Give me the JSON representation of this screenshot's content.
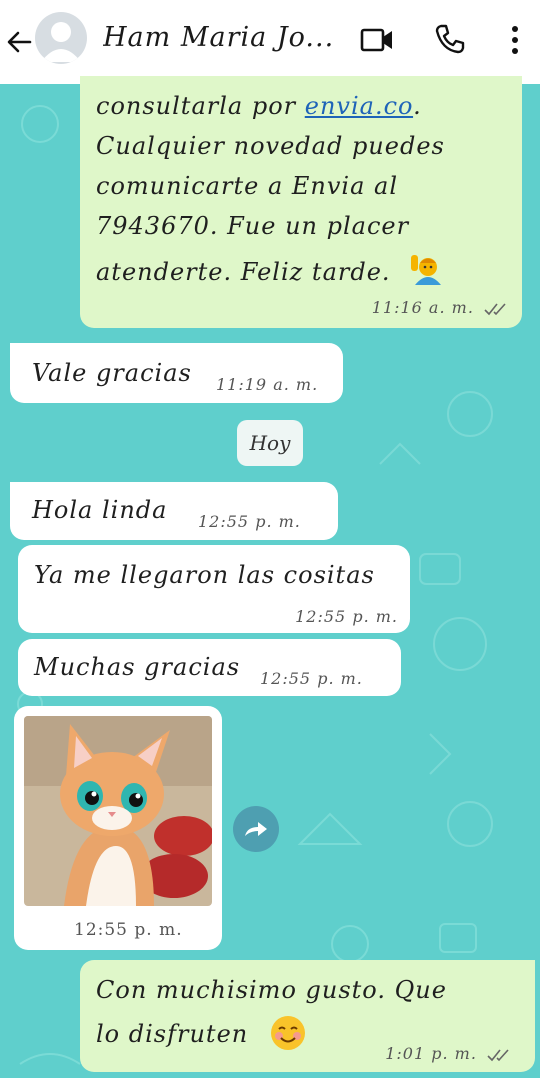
{
  "header": {
    "contact_name": "Ham Maria Jo..."
  },
  "messages": [
    {
      "lines_a": "consultarla por ",
      "link": "envia.co",
      "lines_b": ".",
      "line2": "Cualquier novedad puedes",
      "line3": "comunicarte a Envia al",
      "line4": "7943670. Fue un placer",
      "line5": "atenderte. Feliz tarde.",
      "time": "11:16 a. m."
    },
    {
      "text": "Vale gracias",
      "time": "11:19 a. m."
    },
    {
      "text": "Hola linda",
      "time": "12:55 p. m."
    },
    {
      "text": "Ya me llegaron las cositas",
      "time": "12:55 p. m."
    },
    {
      "text": "Muchas gracias",
      "time": "12:55 p. m."
    },
    {
      "time": "12:55 p. m."
    },
    {
      "line1": "Con muchisimo gusto. Que",
      "line2": "lo disfruten",
      "time": "1:01 p. m."
    }
  ],
  "day_separator": "Hoy",
  "icons": {
    "back": "arrow-left-icon",
    "video": "video-call-icon",
    "call": "phone-icon",
    "menu": "more-vert-icon",
    "forward": "forward-icon"
  },
  "colors": {
    "wallpaper": "#5fcfcc",
    "outgoing": "#dff7c9",
    "incoming": "#ffffff",
    "link": "#1e63b8",
    "read_ticks": "#666666"
  }
}
